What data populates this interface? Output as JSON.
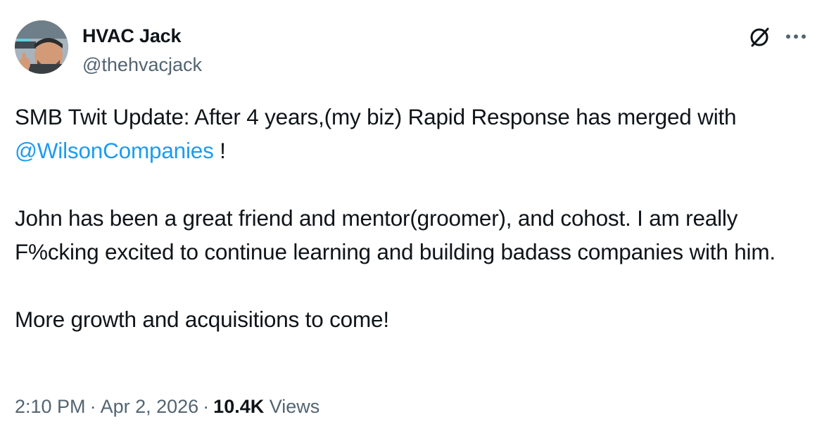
{
  "author": {
    "display_name": "HVAC Jack",
    "handle": "@thehvacjack"
  },
  "icons": {
    "grok": "grok-slash-icon",
    "more": "more-horizontal-icon"
  },
  "tweet": {
    "line1_text": "SMB Twit Update: After 4 years,(my biz) Rapid Response has merged with ",
    "mention": "@WilsonCompanies",
    "line1_suffix": " !",
    "paragraph2": "John has been a great friend and mentor(groomer), and cohost. I am really F%cking excited to continue learning and building badass companies with him.",
    "paragraph3": "More growth and acquisitions to come!"
  },
  "meta": {
    "time": "2:10 PM",
    "separator": "·",
    "date": "Apr 2, 2026",
    "views_count": "10.4K",
    "views_label": "Views"
  },
  "colors": {
    "text": "#0f1419",
    "secondary": "#536471",
    "link": "#1d9bf0"
  }
}
